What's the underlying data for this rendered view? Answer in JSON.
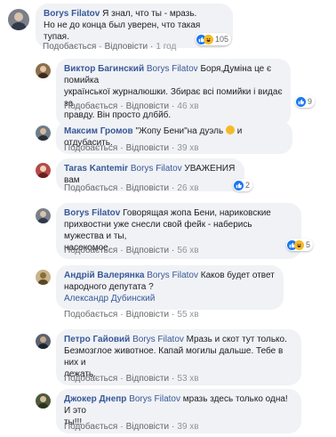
{
  "comments": [
    {
      "author": "Borys Filatov",
      "mention": "",
      "lines": [
        "Я знал, что ты - мразь.",
        "Но не до конца был уверен, что такая тупая."
      ],
      "actions": {
        "like": "Подобається",
        "reply": "Відповісти",
        "time": "1 год"
      },
      "reactions": "105"
    },
    {
      "author": "Виктор Багинский",
      "mention": "Borys Filatov",
      "lines": [
        " Боря,Думіна це є помийка",
        "української журналюшки. Збирає всі помийки і видає за",
        "правду. Він просто длбйб."
      ],
      "actions": {
        "like": "Подобається",
        "reply": "Відповісти",
        "time": "46 хв"
      },
      "reactions": "9"
    },
    {
      "author": "Максим Громов",
      "mention": "",
      "lines": [
        "\"Жопу Бени\"на дуэль",
        " и отдубасить."
      ],
      "actions": {
        "like": "Подобається",
        "reply": "Відповісти",
        "time": "39 хв"
      },
      "reactions": ""
    },
    {
      "author": "Taras Kantemir",
      "mention": "Borys Filatov",
      "lines": [
        " УВАЖЕНИЯ вам"
      ],
      "actions": {
        "like": "Подобається",
        "reply": "Відповісти",
        "time": "26 хв"
      },
      "reactions": "2"
    },
    {
      "author": "Borys Filatov",
      "mention": "",
      "lines": [
        "Говорящая жопа Бени, нариковские",
        "прихвостни уже снесли свой фейк - наберись мужества и ты,",
        "насекомое."
      ],
      "actions": {
        "like": "Подобається",
        "reply": "Відповісти",
        "time": "56 хв"
      },
      "reactions": "5"
    },
    {
      "author": "Андрій Валерянка",
      "mention": "Borys Filatov",
      "lines": [
        " Каков будет ответ",
        "народного депутата ?",
        "Александр Дубинский"
      ],
      "actions": {
        "like": "Подобається",
        "reply": "Відповісти",
        "time": "55 хв"
      },
      "reactions": ""
    },
    {
      "author": "Петро Гайовий",
      "mention": "Borys Filatov",
      "lines": [
        " Мразь и скот тут только.",
        "Безмозглое животное. Капай могилы дальше. Тебе в них и",
        "лежать."
      ],
      "actions": {
        "like": "Подобається",
        "reply": "Відповісти",
        "time": "53 хв"
      },
      "reactions": ""
    },
    {
      "author": "Джокер Днепр",
      "mention": "Borys Filatov",
      "lines": [
        " мразь здесь только одна!И это",
        "ты!!!"
      ],
      "actions": {
        "like": "Подобається",
        "reply": "Відповісти",
        "time": "39 хв"
      },
      "reactions": ""
    }
  ],
  "colors": {
    "name": "#385898",
    "bubble": "#f0f2f5",
    "like": "#1877f2",
    "haha": "#f7b928"
  }
}
